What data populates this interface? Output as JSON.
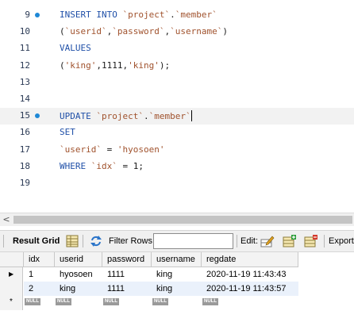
{
  "editor": {
    "lines": [
      {
        "num": "9",
        "marker": true,
        "current": false,
        "tokens": [
          [
            "kw",
            "INSERT INTO "
          ],
          [
            "str",
            "`project`"
          ],
          [
            "plain",
            "."
          ],
          [
            "str",
            "`member`"
          ]
        ]
      },
      {
        "num": "10",
        "marker": false,
        "current": false,
        "tokens": [
          [
            "plain",
            "("
          ],
          [
            "str",
            "`userid`"
          ],
          [
            "plain",
            ","
          ],
          [
            "str",
            "`password`"
          ],
          [
            "plain",
            ","
          ],
          [
            "str",
            "`username`"
          ],
          [
            "plain",
            ")"
          ]
        ]
      },
      {
        "num": "11",
        "marker": false,
        "current": false,
        "tokens": [
          [
            "kw",
            "VALUES"
          ]
        ]
      },
      {
        "num": "12",
        "marker": false,
        "current": false,
        "tokens": [
          [
            "plain",
            "("
          ],
          [
            "str",
            "'king'"
          ],
          [
            "plain",
            ",1111,"
          ],
          [
            "str",
            "'king'"
          ],
          [
            "plain",
            ");"
          ]
        ]
      },
      {
        "num": "13",
        "marker": false,
        "current": false,
        "tokens": []
      },
      {
        "num": "14",
        "marker": false,
        "current": false,
        "tokens": []
      },
      {
        "num": "15",
        "marker": true,
        "current": true,
        "tokens": [
          [
            "kw",
            "UPDATE "
          ],
          [
            "str",
            "`project`"
          ],
          [
            "plain",
            "."
          ],
          [
            "str",
            "`member`"
          ]
        ]
      },
      {
        "num": "16",
        "marker": false,
        "current": false,
        "tokens": [
          [
            "kw",
            "SET"
          ]
        ]
      },
      {
        "num": "17",
        "marker": false,
        "current": false,
        "tokens": [
          [
            "str",
            "`userid`"
          ],
          [
            "plain",
            " = "
          ],
          [
            "str",
            "'hyosoen'"
          ]
        ]
      },
      {
        "num": "18",
        "marker": false,
        "current": false,
        "tokens": [
          [
            "kw",
            "WHERE "
          ],
          [
            "str",
            "`idx`"
          ],
          [
            "plain",
            " = 1;"
          ]
        ]
      },
      {
        "num": "19",
        "marker": false,
        "current": false,
        "tokens": []
      }
    ]
  },
  "scrollbar": {
    "left_arrow": "<"
  },
  "toolbar": {
    "result_grid_label": "Result Grid",
    "filter_rows_label": "Filter Rows:",
    "filter_value": "",
    "edit_label": "Edit:",
    "export_label": "Export/"
  },
  "grid": {
    "columns": [
      "idx",
      "userid",
      "password",
      "username",
      "regdate"
    ],
    "rows": [
      {
        "selected": true,
        "cells": [
          "1",
          "hyosoen",
          "1111",
          "king",
          "2020-11-19 11:43:43"
        ]
      },
      {
        "selected": false,
        "cells": [
          "2",
          "king",
          "1111",
          "king",
          "2020-11-19 11:43:57"
        ]
      }
    ],
    "new_row_marker": "*",
    "current_row_marker": "▶",
    "null_label": "NULL"
  },
  "colors": {
    "keyword": "#2050a8",
    "string": "#a0522d",
    "marker": "#1e88d6",
    "alt_row": "#eaf1fb"
  }
}
